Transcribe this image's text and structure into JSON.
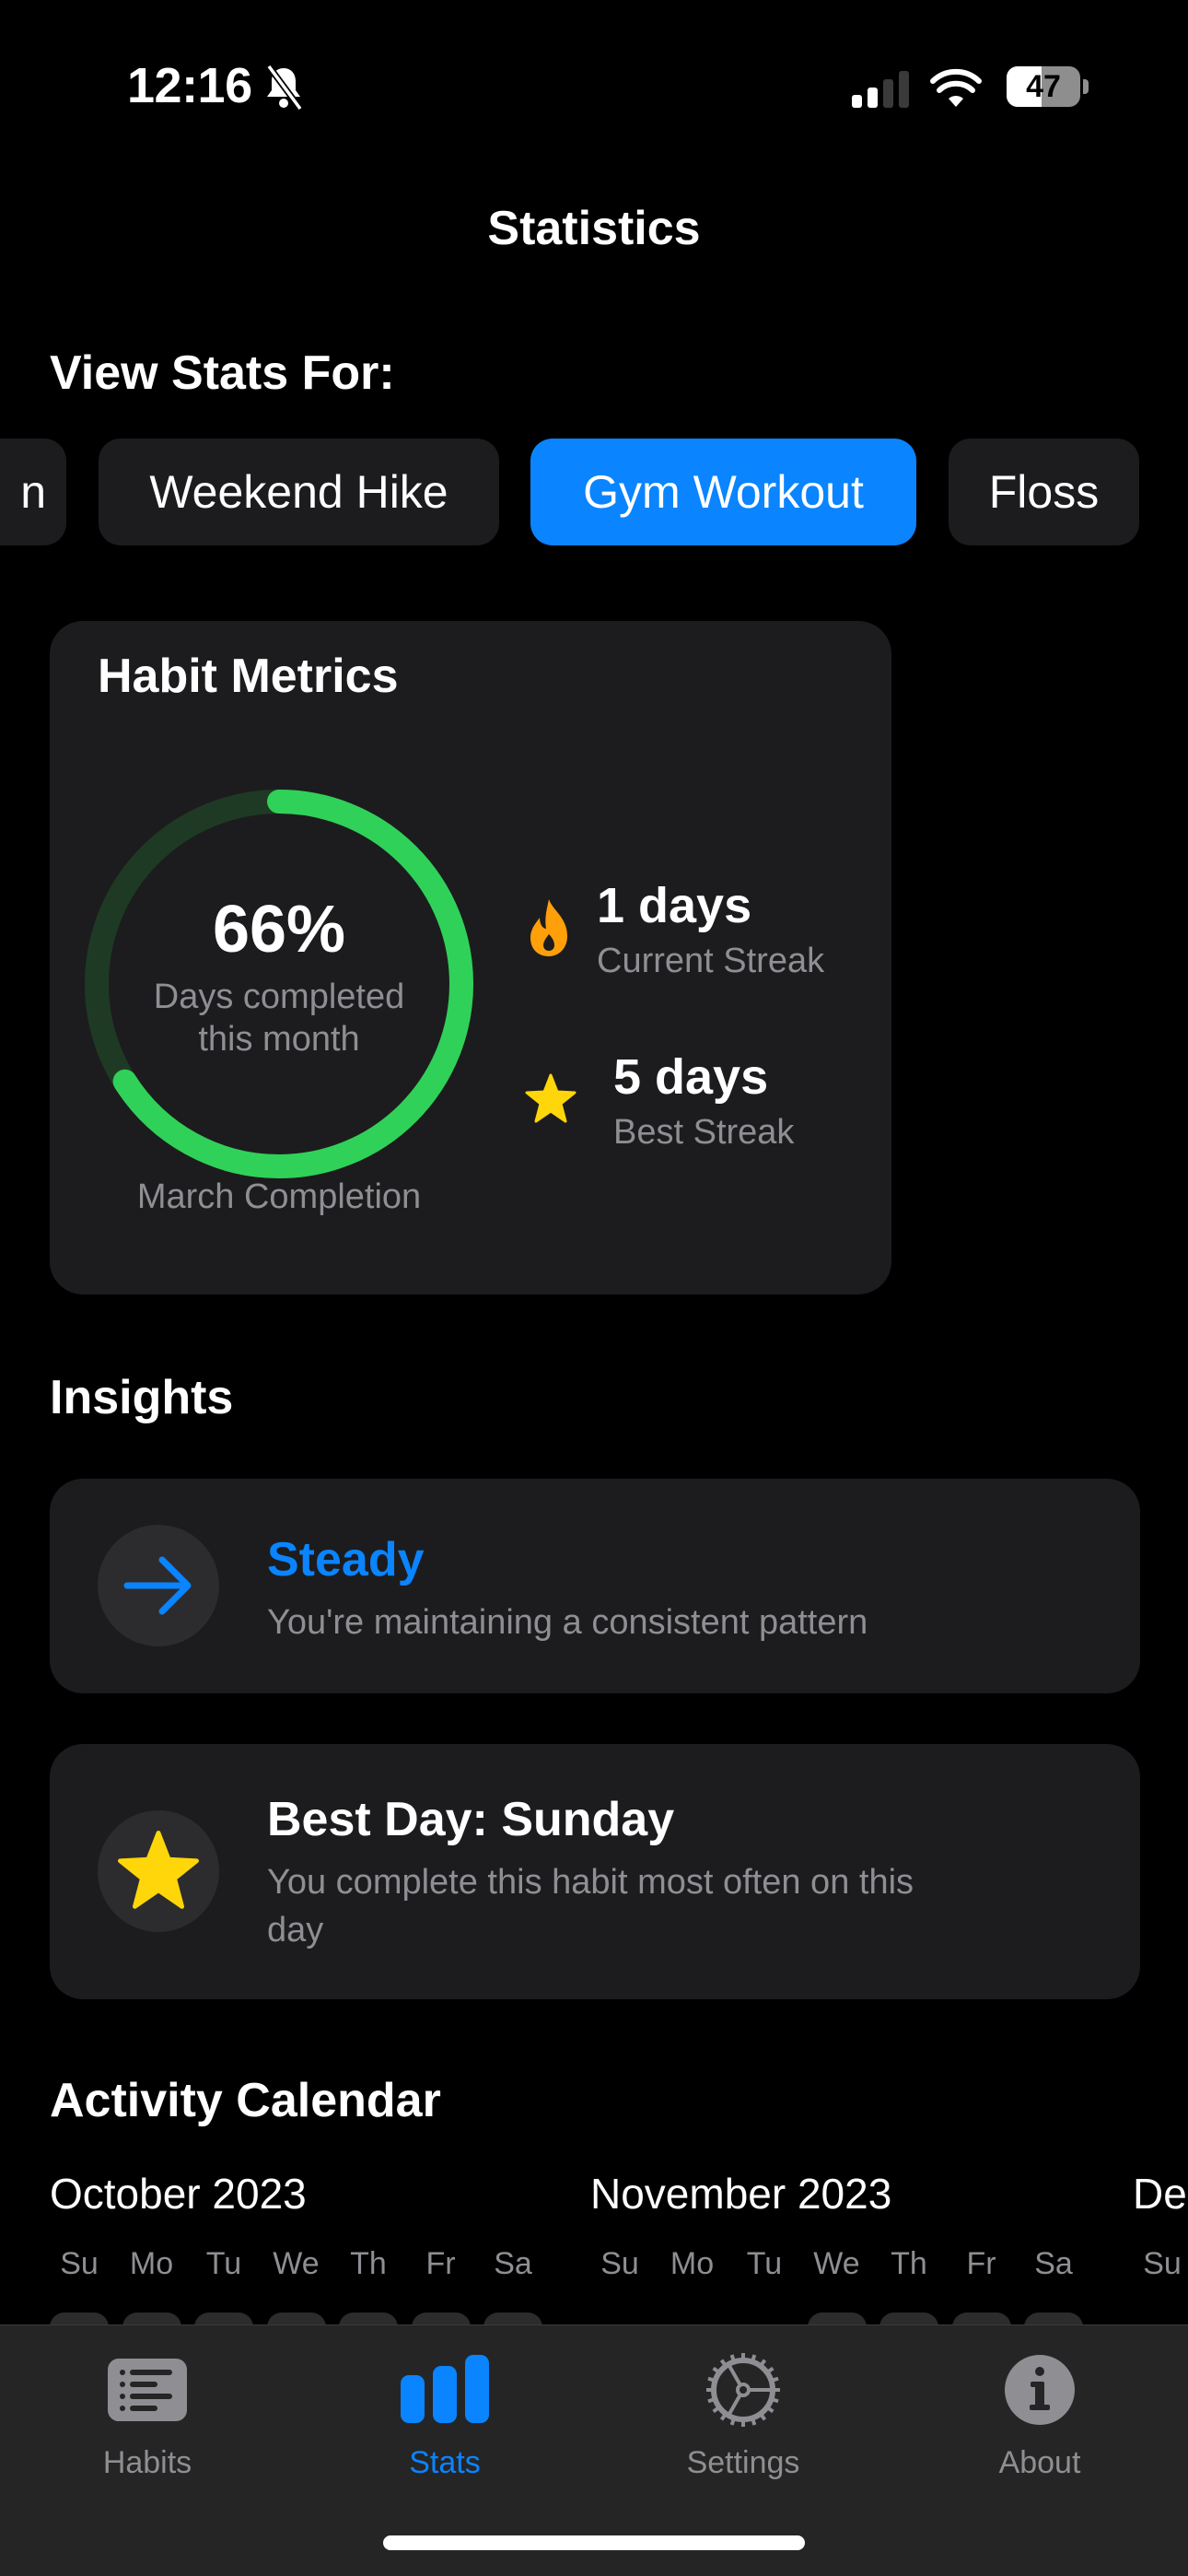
{
  "status_bar": {
    "time": "12:16",
    "silent_mode": true,
    "signal_bars_active": 2,
    "signal_bars_total": 4,
    "battery_percent": 47,
    "battery_label": "47"
  },
  "header": {
    "title": "Statistics"
  },
  "habit_selector": {
    "label": "View Stats For:",
    "chips": [
      {
        "label": "n",
        "active": false,
        "partial": true
      },
      {
        "label": "Weekend Hike",
        "active": false
      },
      {
        "label": "Gym Workout",
        "active": true
      },
      {
        "label": "Floss",
        "active": false
      }
    ]
  },
  "metrics": {
    "title": "Habit Metrics",
    "completion": {
      "percent_label": "66%",
      "fraction": 0.66,
      "caption": "Days completed this month",
      "label": "March Completion"
    },
    "current_streak": {
      "value": "1 days",
      "label": "Current Streak",
      "icon": "flame-icon"
    },
    "best_streak": {
      "value": "5 days",
      "label": "Best Streak",
      "icon": "star-icon"
    }
  },
  "insights": {
    "title": "Insights",
    "items": [
      {
        "icon": "arrow-right-icon",
        "title": "Steady",
        "text": "You're maintaining a consistent pattern",
        "accent": "#0A84FF"
      },
      {
        "icon": "star-icon",
        "title": "Best Day: Sunday",
        "text": "You complete this habit most often on this day",
        "accent": "#FFD60A"
      }
    ]
  },
  "calendar": {
    "title": "Activity Calendar",
    "months": [
      {
        "label": "October 2023",
        "weekdays": [
          "Su",
          "Mo",
          "Tu",
          "We",
          "Th",
          "Fr",
          "Sa"
        ],
        "first_row_visible_days": [
          0,
          1,
          2,
          3,
          4,
          5,
          6
        ]
      },
      {
        "label": "November 2023",
        "weekdays": [
          "Su",
          "Mo",
          "Tu",
          "We",
          "Th",
          "Fr",
          "Sa"
        ],
        "first_row_visible_days": [
          3,
          4,
          5,
          6
        ]
      },
      {
        "label": "De",
        "weekdays": [
          "Su"
        ],
        "first_row_visible_days": []
      }
    ]
  },
  "tabbar": {
    "tabs": [
      {
        "label": "Habits",
        "icon": "list-icon",
        "active": false
      },
      {
        "label": "Stats",
        "icon": "chart-bar-icon",
        "active": true
      },
      {
        "label": "Settings",
        "icon": "gear-icon",
        "active": false
      },
      {
        "label": "About",
        "icon": "info-icon",
        "active": false
      }
    ]
  },
  "colors": {
    "accent": "#0A84FF",
    "ring_progress": "#30D158",
    "ring_track": "#1F3A24",
    "flame": "#FF9F0A",
    "star": "#FFD60A",
    "card_bg": "#1C1C1E",
    "secondary_text": "#8E8E93"
  }
}
